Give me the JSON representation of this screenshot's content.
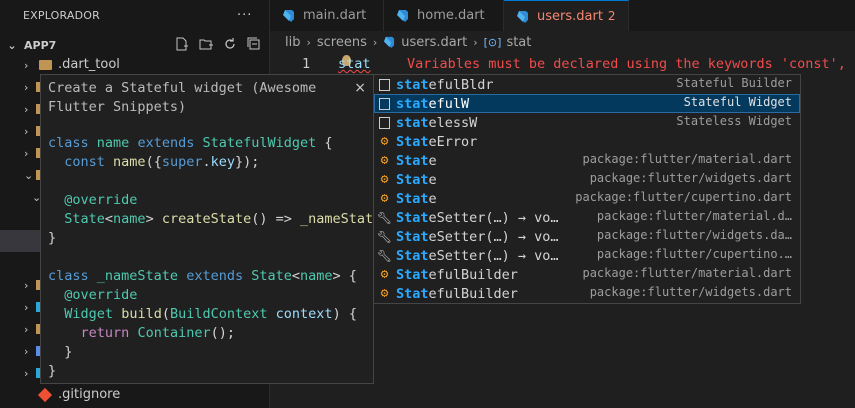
{
  "explorer": {
    "title": "EXPLORADOR",
    "more_icon": "ellipsis-icon",
    "project": "APP7",
    "items": [
      {
        "label": ".dart_tool"
      },
      {
        "label": ".gitignore"
      }
    ]
  },
  "tabs": [
    {
      "label": "main.dart"
    },
    {
      "label": "home.dart"
    },
    {
      "label": "users.dart",
      "badge": "2"
    }
  ],
  "breadcrumb": {
    "parts": [
      "lib",
      "screens",
      "users.dart",
      "stat"
    ]
  },
  "editor": {
    "line_number": "1",
    "typed": "stat",
    "error": "Variables must be declared using the keywords 'const',"
  },
  "suggest": {
    "items": [
      {
        "prefix": "stat",
        "rest": "efulBldr",
        "detail": "Stateful Builder",
        "icon": "snippet-icon"
      },
      {
        "prefix": "stat",
        "rest": "efulW",
        "detail": "Stateful Widget",
        "icon": "snippet-icon"
      },
      {
        "prefix": "stat",
        "rest": "elessW",
        "detail": "Stateless Widget",
        "icon": "snippet-icon"
      },
      {
        "prefix": "Stat",
        "rest": "eError",
        "detail": "",
        "icon": "class-icon"
      },
      {
        "prefix": "Stat",
        "rest": "e",
        "detail": "package:flutter/material.dart",
        "icon": "class-icon"
      },
      {
        "prefix": "Stat",
        "rest": "e",
        "detail": "package:flutter/widgets.dart",
        "icon": "class-icon"
      },
      {
        "prefix": "Stat",
        "rest": "e",
        "detail": "package:flutter/cupertino.dart",
        "icon": "class-icon"
      },
      {
        "prefix": "Stat",
        "rest": "eSetter(…) → vo…",
        "detail": "package:flutter/material.d…",
        "icon": "wrench-icon"
      },
      {
        "prefix": "Stat",
        "rest": "eSetter(…) → vo…",
        "detail": "package:flutter/widgets.da…",
        "icon": "wrench-icon"
      },
      {
        "prefix": "Stat",
        "rest": "eSetter(…) → vo…",
        "detail": "package:flutter/cupertino.…",
        "icon": "wrench-icon"
      },
      {
        "prefix": "Stat",
        "rest": "efulBuilder",
        "detail": "package:flutter/material.dart",
        "icon": "class-icon"
      },
      {
        "prefix": "Stat",
        "rest": "efulBuilder",
        "detail": "package:flutter/widgets.dart",
        "icon": "class-icon"
      }
    ]
  },
  "details": {
    "title": "Create a Stateful widget (Awesome Flutter Snippets)",
    "close": "×"
  },
  "colors": {
    "accent": "#0078d4",
    "error": "#f14c4c",
    "highlight": "#2aaaff",
    "selected_row": "#04395e"
  }
}
